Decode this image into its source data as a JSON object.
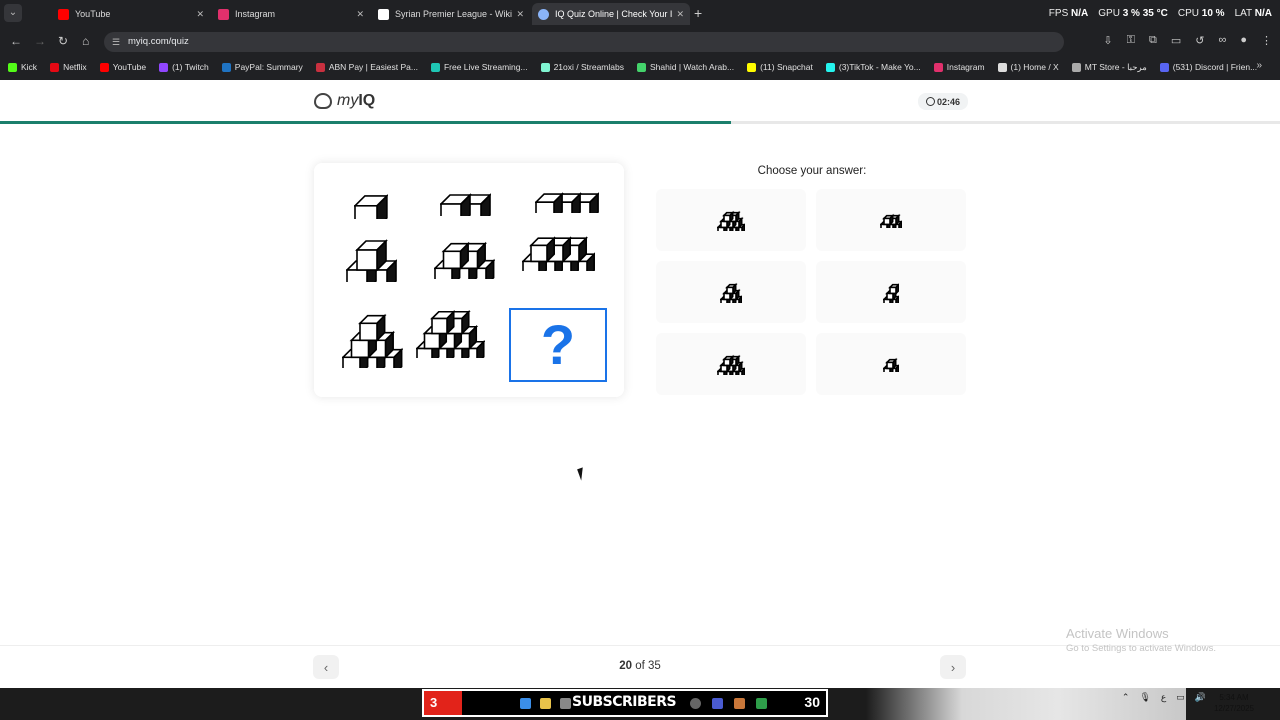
{
  "browser": {
    "tabs": [
      {
        "label": "YouTube",
        "color": "#ff0000",
        "active": false
      },
      {
        "label": "Instagram",
        "color": "#e1306c",
        "active": false
      },
      {
        "label": "Syrian Premier League - Wikipe",
        "color": "#ffffff",
        "active": false
      },
      {
        "label": "IQ Quiz Online | Check Your IQ",
        "color": "#8ab4f8",
        "active": true
      }
    ],
    "hud": {
      "fps_label": "FPS",
      "fps": "N/A",
      "gpu_label": "GPU",
      "gpu_load": "3 %",
      "gpu_temp": "35 °C",
      "cpu_label": "CPU",
      "cpu_load": "10 %",
      "lat_label": "LAT",
      "lat": "N/A"
    },
    "url": "myiq.com/quiz",
    "bookmarks": [
      {
        "label": "Kick",
        "color": "#53fc18"
      },
      {
        "label": "Netflix",
        "color": "#e50914"
      },
      {
        "label": "YouTube",
        "color": "#ff0000"
      },
      {
        "label": "(1) Twitch",
        "color": "#9146ff"
      },
      {
        "label": "PayPal: Summary",
        "color": "#1f73c2"
      },
      {
        "label": "ABN Pay | Easiest Pa...",
        "color": "#c9303f"
      },
      {
        "label": "Free Live Streaming...",
        "color": "#1fc7b5"
      },
      {
        "label": "21oxi / Streamlabs",
        "color": "#80f5d2"
      },
      {
        "label": "Shahid | Watch Arab...",
        "color": "#44d36b"
      },
      {
        "label": "(11) Snapchat",
        "color": "#fffc00"
      },
      {
        "label": "(3)TikTok - Make Yo...",
        "color": "#25f4ee"
      },
      {
        "label": "Instagram",
        "color": "#e1306c"
      },
      {
        "label": "(1) Home / X",
        "color": "#dddddd"
      },
      {
        "label": "MT Store - مرحبا",
        "color": "#aaaaaa"
      },
      {
        "label": "(531) Discord | Frien...",
        "color": "#5865f2"
      }
    ]
  },
  "site": {
    "logo_prefix": "my",
    "logo_bold": "IQ",
    "timer": "02:46",
    "progress": 0.571
  },
  "quiz": {
    "answers_title": "Choose your answer:",
    "current": "20",
    "of_label": "of",
    "total": "35"
  },
  "windows_watermark": {
    "title": "Activate Windows",
    "subtitle": "Go to Settings to activate Windows."
  },
  "taskbar": {
    "banner_left": "3",
    "banner_text": "SUBSCRIBERS",
    "banner_right": "30",
    "time": "5:34 AM",
    "date": "12/27/2025"
  },
  "colors": {
    "accent": "#1a73e8",
    "progress": "#1b7f6c"
  }
}
